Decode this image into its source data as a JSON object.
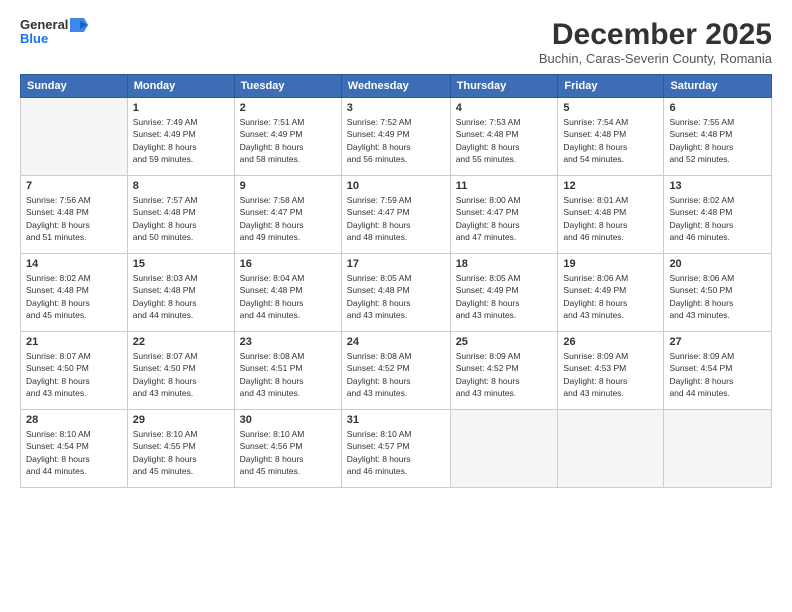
{
  "logo": {
    "line1": "General",
    "line2": "Blue"
  },
  "title": "December 2025",
  "subtitle": "Buchin, Caras-Severin County, Romania",
  "headers": [
    "Sunday",
    "Monday",
    "Tuesday",
    "Wednesday",
    "Thursday",
    "Friday",
    "Saturday"
  ],
  "weeks": [
    [
      {
        "day": "",
        "info": ""
      },
      {
        "day": "1",
        "info": "Sunrise: 7:49 AM\nSunset: 4:49 PM\nDaylight: 8 hours\nand 59 minutes."
      },
      {
        "day": "2",
        "info": "Sunrise: 7:51 AM\nSunset: 4:49 PM\nDaylight: 8 hours\nand 58 minutes."
      },
      {
        "day": "3",
        "info": "Sunrise: 7:52 AM\nSunset: 4:49 PM\nDaylight: 8 hours\nand 56 minutes."
      },
      {
        "day": "4",
        "info": "Sunrise: 7:53 AM\nSunset: 4:48 PM\nDaylight: 8 hours\nand 55 minutes."
      },
      {
        "day": "5",
        "info": "Sunrise: 7:54 AM\nSunset: 4:48 PM\nDaylight: 8 hours\nand 54 minutes."
      },
      {
        "day": "6",
        "info": "Sunrise: 7:55 AM\nSunset: 4:48 PM\nDaylight: 8 hours\nand 52 minutes."
      }
    ],
    [
      {
        "day": "7",
        "info": "Sunrise: 7:56 AM\nSunset: 4:48 PM\nDaylight: 8 hours\nand 51 minutes."
      },
      {
        "day": "8",
        "info": "Sunrise: 7:57 AM\nSunset: 4:48 PM\nDaylight: 8 hours\nand 50 minutes."
      },
      {
        "day": "9",
        "info": "Sunrise: 7:58 AM\nSunset: 4:47 PM\nDaylight: 8 hours\nand 49 minutes."
      },
      {
        "day": "10",
        "info": "Sunrise: 7:59 AM\nSunset: 4:47 PM\nDaylight: 8 hours\nand 48 minutes."
      },
      {
        "day": "11",
        "info": "Sunrise: 8:00 AM\nSunset: 4:47 PM\nDaylight: 8 hours\nand 47 minutes."
      },
      {
        "day": "12",
        "info": "Sunrise: 8:01 AM\nSunset: 4:48 PM\nDaylight: 8 hours\nand 46 minutes."
      },
      {
        "day": "13",
        "info": "Sunrise: 8:02 AM\nSunset: 4:48 PM\nDaylight: 8 hours\nand 46 minutes."
      }
    ],
    [
      {
        "day": "14",
        "info": "Sunrise: 8:02 AM\nSunset: 4:48 PM\nDaylight: 8 hours\nand 45 minutes."
      },
      {
        "day": "15",
        "info": "Sunrise: 8:03 AM\nSunset: 4:48 PM\nDaylight: 8 hours\nand 44 minutes."
      },
      {
        "day": "16",
        "info": "Sunrise: 8:04 AM\nSunset: 4:48 PM\nDaylight: 8 hours\nand 44 minutes."
      },
      {
        "day": "17",
        "info": "Sunrise: 8:05 AM\nSunset: 4:48 PM\nDaylight: 8 hours\nand 43 minutes."
      },
      {
        "day": "18",
        "info": "Sunrise: 8:05 AM\nSunset: 4:49 PM\nDaylight: 8 hours\nand 43 minutes."
      },
      {
        "day": "19",
        "info": "Sunrise: 8:06 AM\nSunset: 4:49 PM\nDaylight: 8 hours\nand 43 minutes."
      },
      {
        "day": "20",
        "info": "Sunrise: 8:06 AM\nSunset: 4:50 PM\nDaylight: 8 hours\nand 43 minutes."
      }
    ],
    [
      {
        "day": "21",
        "info": "Sunrise: 8:07 AM\nSunset: 4:50 PM\nDaylight: 8 hours\nand 43 minutes."
      },
      {
        "day": "22",
        "info": "Sunrise: 8:07 AM\nSunset: 4:50 PM\nDaylight: 8 hours\nand 43 minutes."
      },
      {
        "day": "23",
        "info": "Sunrise: 8:08 AM\nSunset: 4:51 PM\nDaylight: 8 hours\nand 43 minutes."
      },
      {
        "day": "24",
        "info": "Sunrise: 8:08 AM\nSunset: 4:52 PM\nDaylight: 8 hours\nand 43 minutes."
      },
      {
        "day": "25",
        "info": "Sunrise: 8:09 AM\nSunset: 4:52 PM\nDaylight: 8 hours\nand 43 minutes."
      },
      {
        "day": "26",
        "info": "Sunrise: 8:09 AM\nSunset: 4:53 PM\nDaylight: 8 hours\nand 43 minutes."
      },
      {
        "day": "27",
        "info": "Sunrise: 8:09 AM\nSunset: 4:54 PM\nDaylight: 8 hours\nand 44 minutes."
      }
    ],
    [
      {
        "day": "28",
        "info": "Sunrise: 8:10 AM\nSunset: 4:54 PM\nDaylight: 8 hours\nand 44 minutes."
      },
      {
        "day": "29",
        "info": "Sunrise: 8:10 AM\nSunset: 4:55 PM\nDaylight: 8 hours\nand 45 minutes."
      },
      {
        "day": "30",
        "info": "Sunrise: 8:10 AM\nSunset: 4:56 PM\nDaylight: 8 hours\nand 45 minutes."
      },
      {
        "day": "31",
        "info": "Sunrise: 8:10 AM\nSunset: 4:57 PM\nDaylight: 8 hours\nand 46 minutes."
      },
      {
        "day": "",
        "info": ""
      },
      {
        "day": "",
        "info": ""
      },
      {
        "day": "",
        "info": ""
      }
    ]
  ]
}
